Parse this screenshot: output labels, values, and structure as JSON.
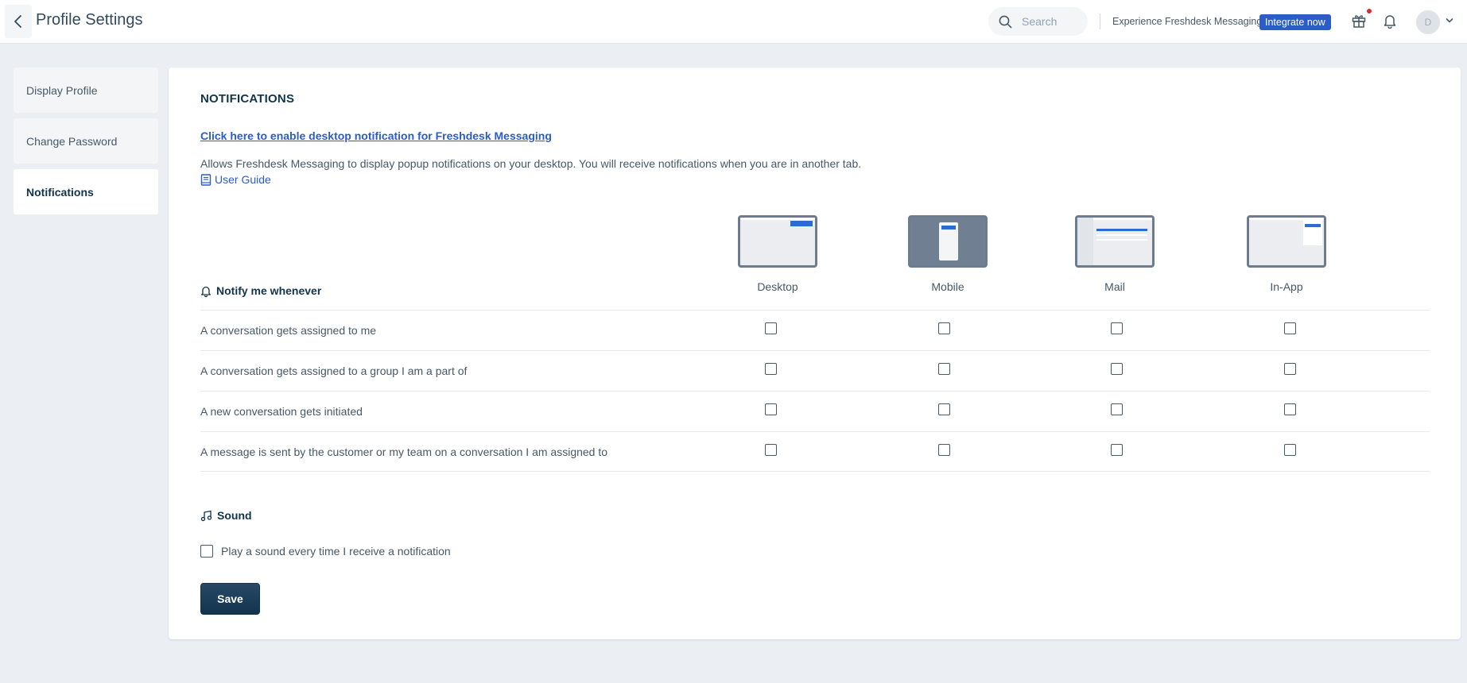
{
  "header": {
    "title": "Profile Settings",
    "search_placeholder": "Search",
    "experience_text": "Experience Freshdesk Messaging",
    "integrate_label": "Integrate now",
    "avatar_initial": "D"
  },
  "sidebar": {
    "items": [
      {
        "label": "Display Profile",
        "active": false
      },
      {
        "label": "Change Password",
        "active": false
      },
      {
        "label": "Notifications",
        "active": true
      }
    ]
  },
  "notifications": {
    "title": "NOTIFICATIONS",
    "enable_link": "Click here to enable desktop notification for Freshdesk Messaging",
    "description": "Allows Freshdesk Messaging to display popup notifications on your desktop. You will receive notifications when you are in another tab.",
    "user_guide": "User Guide",
    "notify_heading": "Notify me whenever",
    "channels": [
      "Desktop",
      "Mobile",
      "Mail",
      "In-App"
    ],
    "rows": [
      {
        "label": "A conversation gets assigned to me",
        "checked": [
          false,
          false,
          false,
          false
        ]
      },
      {
        "label": "A conversation gets assigned to a group I am a part of",
        "checked": [
          false,
          false,
          false,
          false
        ]
      },
      {
        "label": "A new conversation gets initiated",
        "checked": [
          false,
          false,
          false,
          false
        ]
      },
      {
        "label": "A message is sent by the customer or my team on a conversation I am assigned to",
        "checked": [
          false,
          false,
          false,
          false
        ]
      }
    ],
    "sound_heading": "Sound",
    "sound_option": "Play a sound every time I receive a notification",
    "sound_checked": false,
    "save_label": "Save"
  },
  "colors": {
    "accent": "#2c5cc5",
    "primary_dark": "#12344d",
    "notification_dot": "#d72d30",
    "background": "#ebeef3"
  }
}
